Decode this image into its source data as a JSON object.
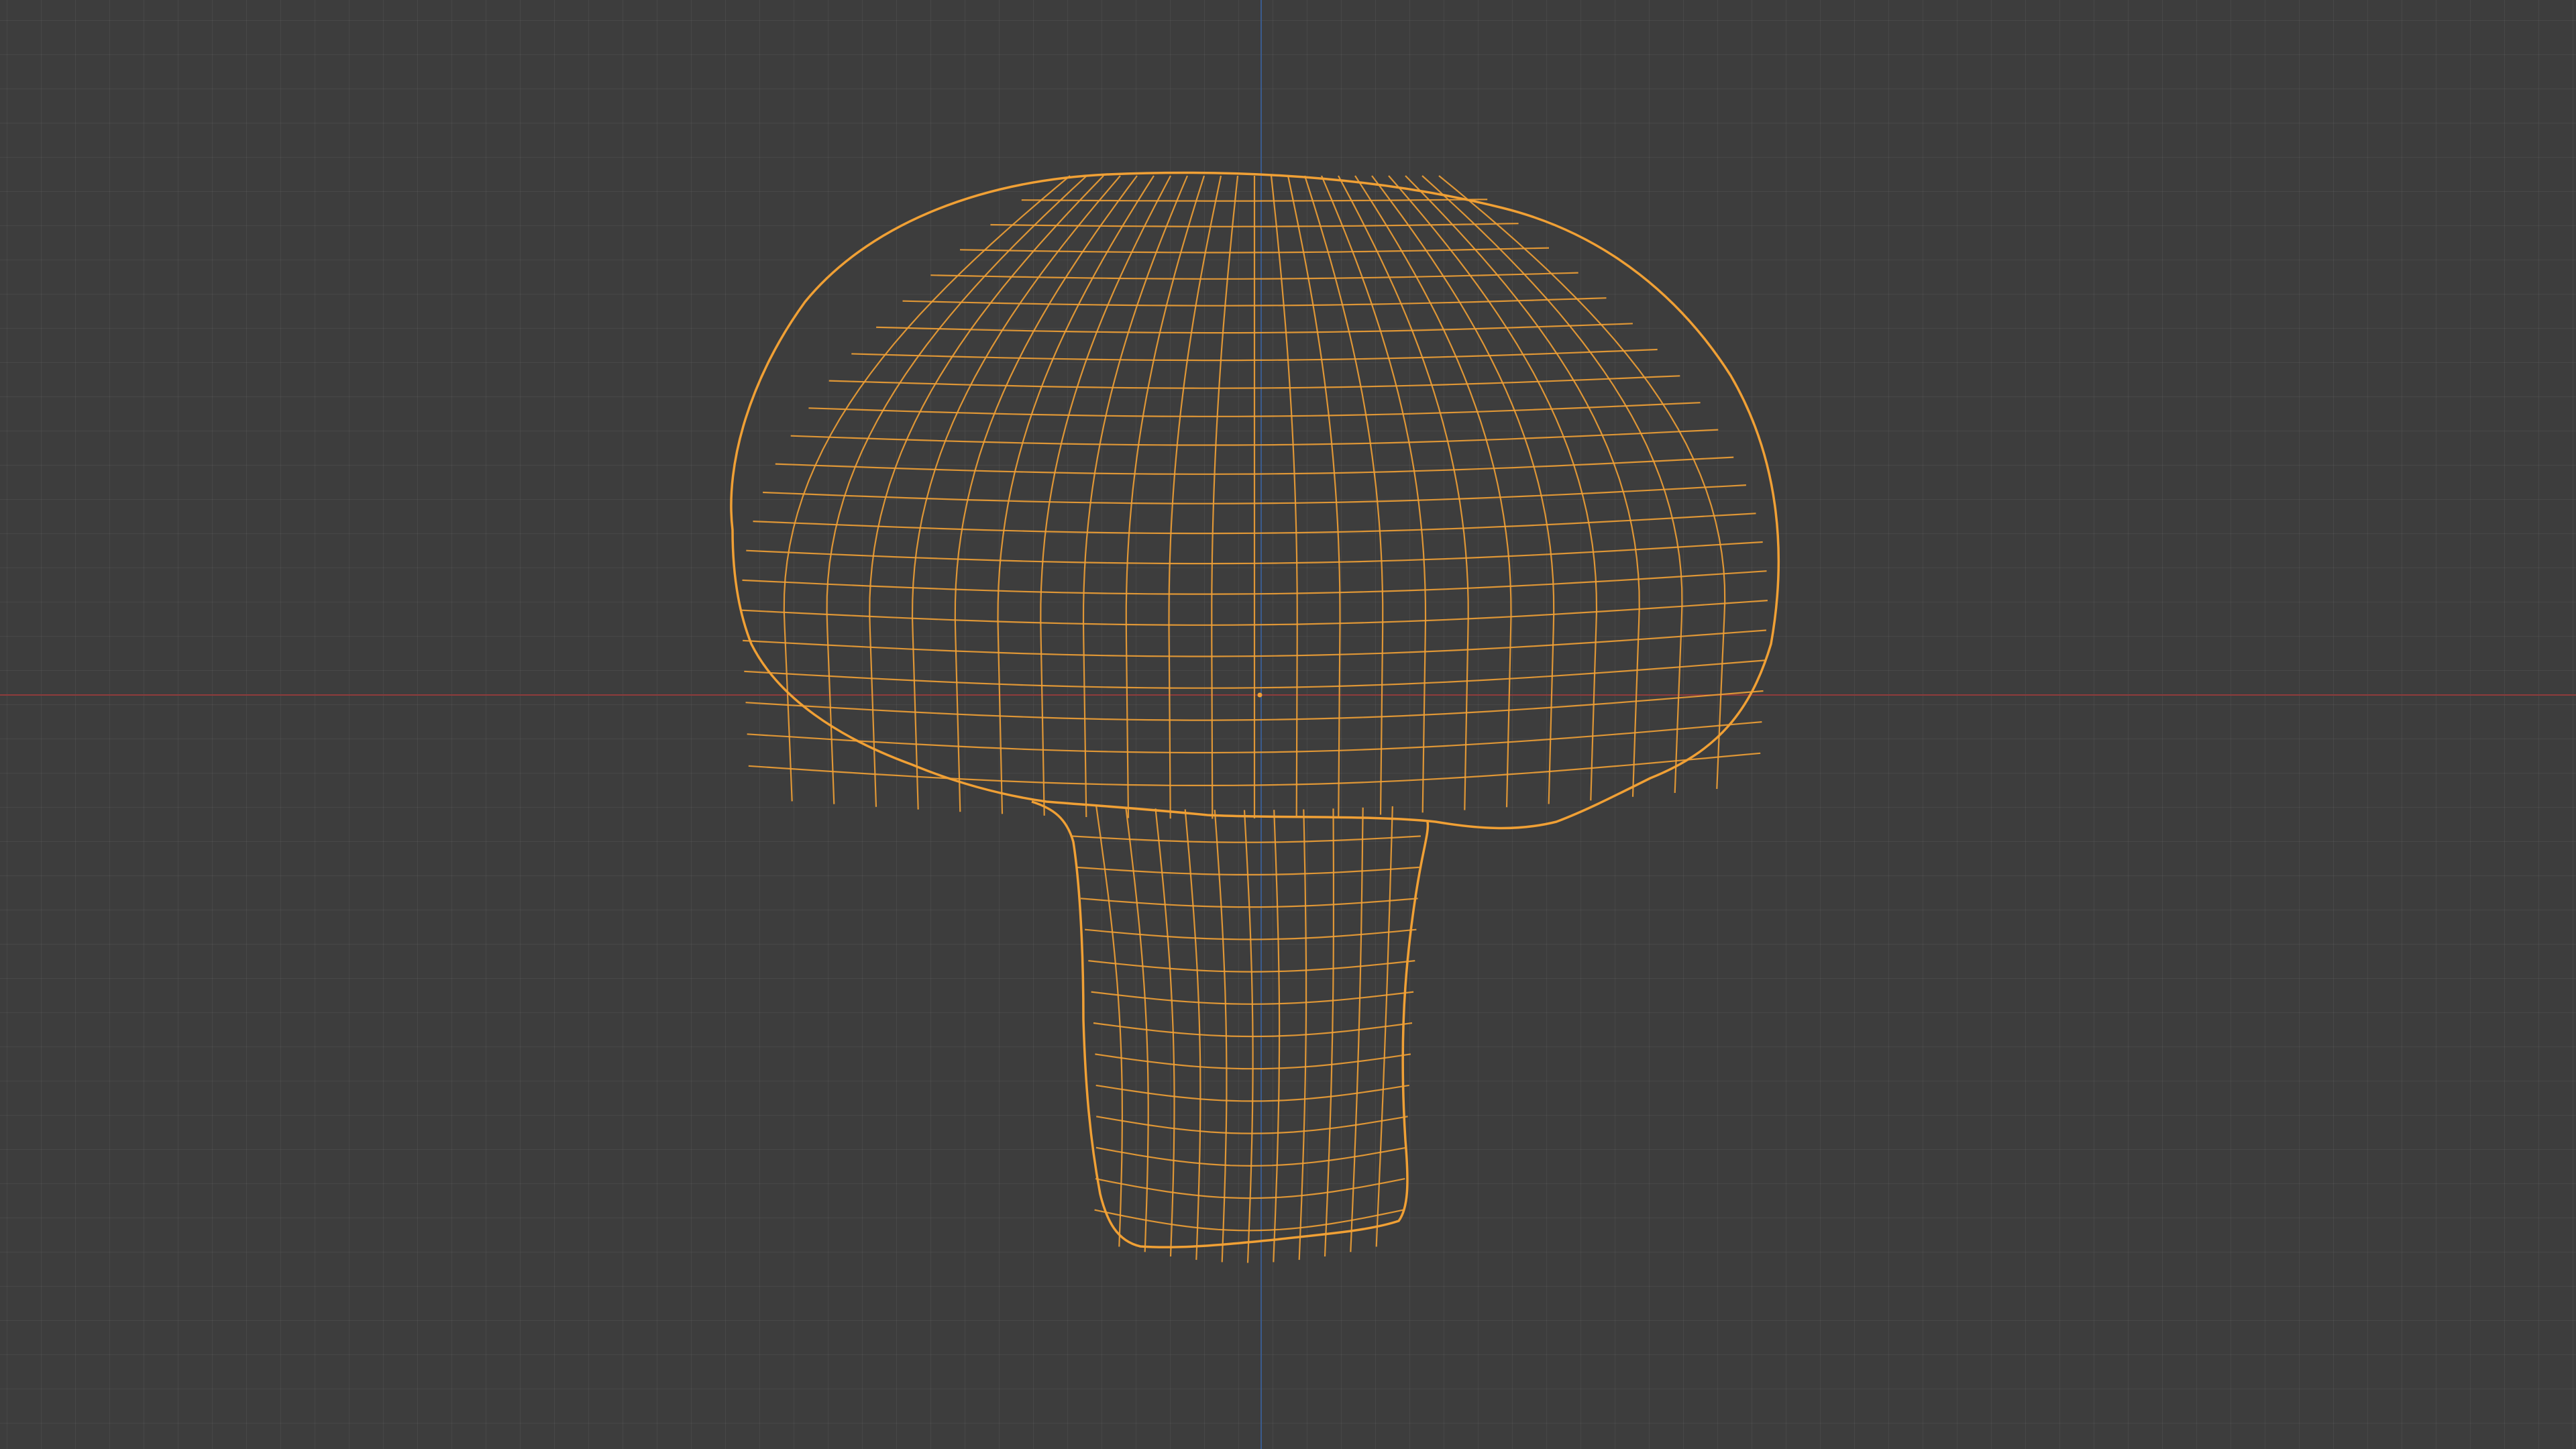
{
  "viewport": {
    "name": "3D Viewport",
    "shading_mode": "wireframe",
    "background_color": "#3d3d3d",
    "grid_color": "#484848"
  },
  "axes": {
    "x_axis_color": "#8e3b3b",
    "z_axis_color": "#3b5c8e"
  },
  "object": {
    "shape": "mushroom",
    "selected": true,
    "wire_color": "#f0a035",
    "origin_color": "#f0a035"
  }
}
